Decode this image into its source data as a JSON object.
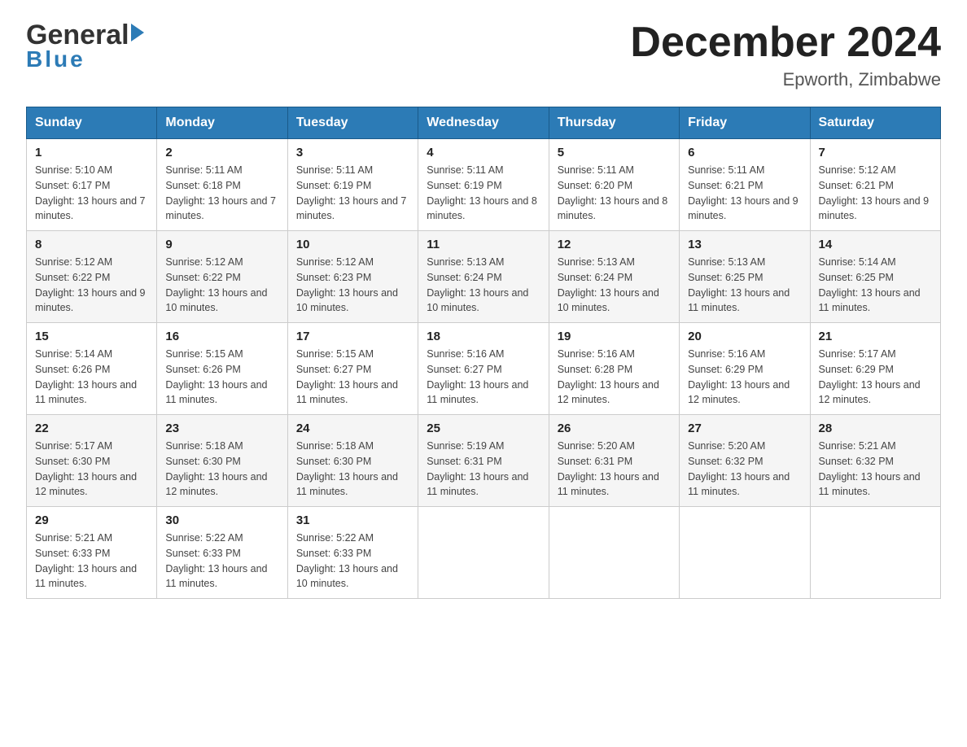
{
  "logo": {
    "general": "General",
    "blue": "Blue"
  },
  "header": {
    "month": "December 2024",
    "location": "Epworth, Zimbabwe"
  },
  "weekdays": [
    "Sunday",
    "Monday",
    "Tuesday",
    "Wednesday",
    "Thursday",
    "Friday",
    "Saturday"
  ],
  "weeks": [
    [
      {
        "day": "1",
        "sunrise": "5:10 AM",
        "sunset": "6:17 PM",
        "daylight": "13 hours and 7 minutes."
      },
      {
        "day": "2",
        "sunrise": "5:11 AM",
        "sunset": "6:18 PM",
        "daylight": "13 hours and 7 minutes."
      },
      {
        "day": "3",
        "sunrise": "5:11 AM",
        "sunset": "6:19 PM",
        "daylight": "13 hours and 7 minutes."
      },
      {
        "day": "4",
        "sunrise": "5:11 AM",
        "sunset": "6:19 PM",
        "daylight": "13 hours and 8 minutes."
      },
      {
        "day": "5",
        "sunrise": "5:11 AM",
        "sunset": "6:20 PM",
        "daylight": "13 hours and 8 minutes."
      },
      {
        "day": "6",
        "sunrise": "5:11 AM",
        "sunset": "6:21 PM",
        "daylight": "13 hours and 9 minutes."
      },
      {
        "day": "7",
        "sunrise": "5:12 AM",
        "sunset": "6:21 PM",
        "daylight": "13 hours and 9 minutes."
      }
    ],
    [
      {
        "day": "8",
        "sunrise": "5:12 AM",
        "sunset": "6:22 PM",
        "daylight": "13 hours and 9 minutes."
      },
      {
        "day": "9",
        "sunrise": "5:12 AM",
        "sunset": "6:22 PM",
        "daylight": "13 hours and 10 minutes."
      },
      {
        "day": "10",
        "sunrise": "5:12 AM",
        "sunset": "6:23 PM",
        "daylight": "13 hours and 10 minutes."
      },
      {
        "day": "11",
        "sunrise": "5:13 AM",
        "sunset": "6:24 PM",
        "daylight": "13 hours and 10 minutes."
      },
      {
        "day": "12",
        "sunrise": "5:13 AM",
        "sunset": "6:24 PM",
        "daylight": "13 hours and 10 minutes."
      },
      {
        "day": "13",
        "sunrise": "5:13 AM",
        "sunset": "6:25 PM",
        "daylight": "13 hours and 11 minutes."
      },
      {
        "day": "14",
        "sunrise": "5:14 AM",
        "sunset": "6:25 PM",
        "daylight": "13 hours and 11 minutes."
      }
    ],
    [
      {
        "day": "15",
        "sunrise": "5:14 AM",
        "sunset": "6:26 PM",
        "daylight": "13 hours and 11 minutes."
      },
      {
        "day": "16",
        "sunrise": "5:15 AM",
        "sunset": "6:26 PM",
        "daylight": "13 hours and 11 minutes."
      },
      {
        "day": "17",
        "sunrise": "5:15 AM",
        "sunset": "6:27 PM",
        "daylight": "13 hours and 11 minutes."
      },
      {
        "day": "18",
        "sunrise": "5:16 AM",
        "sunset": "6:27 PM",
        "daylight": "13 hours and 11 minutes."
      },
      {
        "day": "19",
        "sunrise": "5:16 AM",
        "sunset": "6:28 PM",
        "daylight": "13 hours and 12 minutes."
      },
      {
        "day": "20",
        "sunrise": "5:16 AM",
        "sunset": "6:29 PM",
        "daylight": "13 hours and 12 minutes."
      },
      {
        "day": "21",
        "sunrise": "5:17 AM",
        "sunset": "6:29 PM",
        "daylight": "13 hours and 12 minutes."
      }
    ],
    [
      {
        "day": "22",
        "sunrise": "5:17 AM",
        "sunset": "6:30 PM",
        "daylight": "13 hours and 12 minutes."
      },
      {
        "day": "23",
        "sunrise": "5:18 AM",
        "sunset": "6:30 PM",
        "daylight": "13 hours and 12 minutes."
      },
      {
        "day": "24",
        "sunrise": "5:18 AM",
        "sunset": "6:30 PM",
        "daylight": "13 hours and 11 minutes."
      },
      {
        "day": "25",
        "sunrise": "5:19 AM",
        "sunset": "6:31 PM",
        "daylight": "13 hours and 11 minutes."
      },
      {
        "day": "26",
        "sunrise": "5:20 AM",
        "sunset": "6:31 PM",
        "daylight": "13 hours and 11 minutes."
      },
      {
        "day": "27",
        "sunrise": "5:20 AM",
        "sunset": "6:32 PM",
        "daylight": "13 hours and 11 minutes."
      },
      {
        "day": "28",
        "sunrise": "5:21 AM",
        "sunset": "6:32 PM",
        "daylight": "13 hours and 11 minutes."
      }
    ],
    [
      {
        "day": "29",
        "sunrise": "5:21 AM",
        "sunset": "6:33 PM",
        "daylight": "13 hours and 11 minutes."
      },
      {
        "day": "30",
        "sunrise": "5:22 AM",
        "sunset": "6:33 PM",
        "daylight": "13 hours and 11 minutes."
      },
      {
        "day": "31",
        "sunrise": "5:22 AM",
        "sunset": "6:33 PM",
        "daylight": "13 hours and 10 minutes."
      },
      null,
      null,
      null,
      null
    ]
  ]
}
